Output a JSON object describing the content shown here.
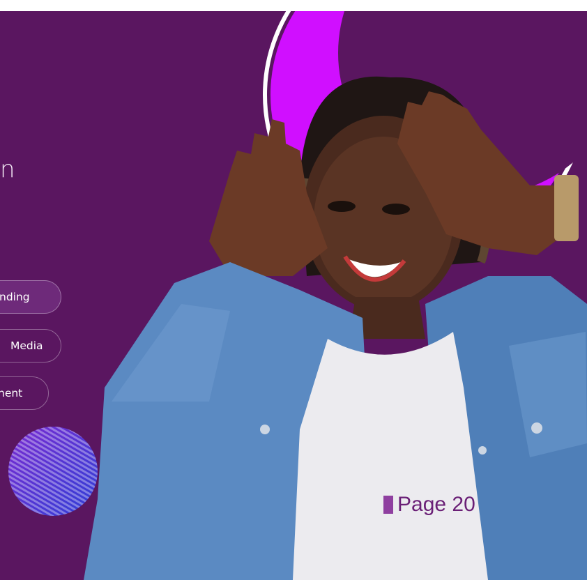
{
  "colors": {
    "background": "#5a1660",
    "accent_magenta": "#d00fff",
    "page_tag": "#8f3fa0",
    "page_text": "#6a1f76"
  },
  "heading_fragment": "n",
  "services": [
    {
      "label": "nding",
      "active": true
    },
    {
      "label": "Media",
      "active": false
    },
    {
      "label": "nent",
      "active": false
    }
  ],
  "photo": {
    "icon": "smiling-woman-framing-face-photo"
  },
  "page_label": "Page 20"
}
